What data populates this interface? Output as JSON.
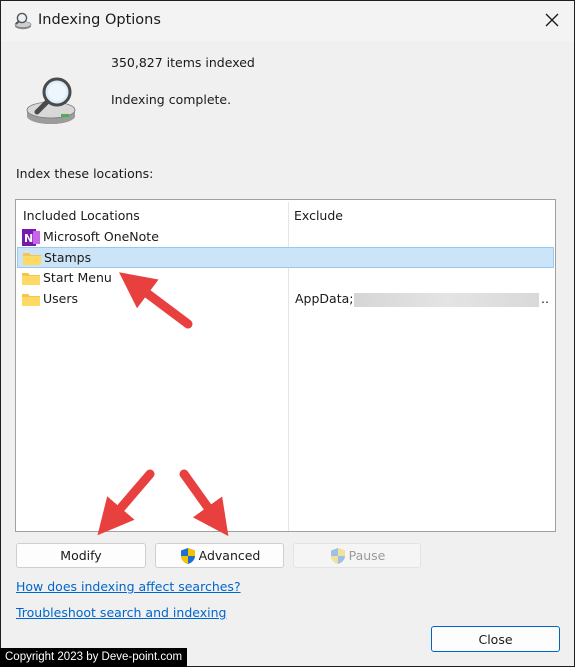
{
  "window": {
    "title": "Indexing Options",
    "icon": "magnifier-drive-icon"
  },
  "status": {
    "items_indexed": "350,827 items indexed",
    "state": "Indexing complete."
  },
  "locations": {
    "label": "Index these locations:",
    "columns": {
      "included": "Included Locations",
      "exclude": "Exclude"
    },
    "rows": [
      {
        "name": "Microsoft OneNote",
        "icon": "onenote-icon",
        "exclude": "",
        "selected": false
      },
      {
        "name": "Stamps",
        "icon": "folder-icon",
        "exclude": "",
        "selected": true
      },
      {
        "name": "Start Menu",
        "icon": "folder-icon",
        "exclude": "",
        "selected": false
      },
      {
        "name": "Users",
        "icon": "folder-icon",
        "exclude": "AppData;",
        "exclude_more": "..",
        "selected": false
      }
    ]
  },
  "buttons": {
    "modify": "Modify",
    "advanced": "Advanced",
    "pause": "Pause",
    "close": "Close"
  },
  "links": {
    "how_indexing": "How does indexing affect searches?",
    "troubleshoot": "Troubleshoot search and indexing"
  },
  "watermark": "Copyright 2023 by Deve-point.com",
  "colors": {
    "accent": "#0067c0",
    "selection": "#cce4f7",
    "link": "#0066cc",
    "annotation_arrow": "#e8403f"
  }
}
